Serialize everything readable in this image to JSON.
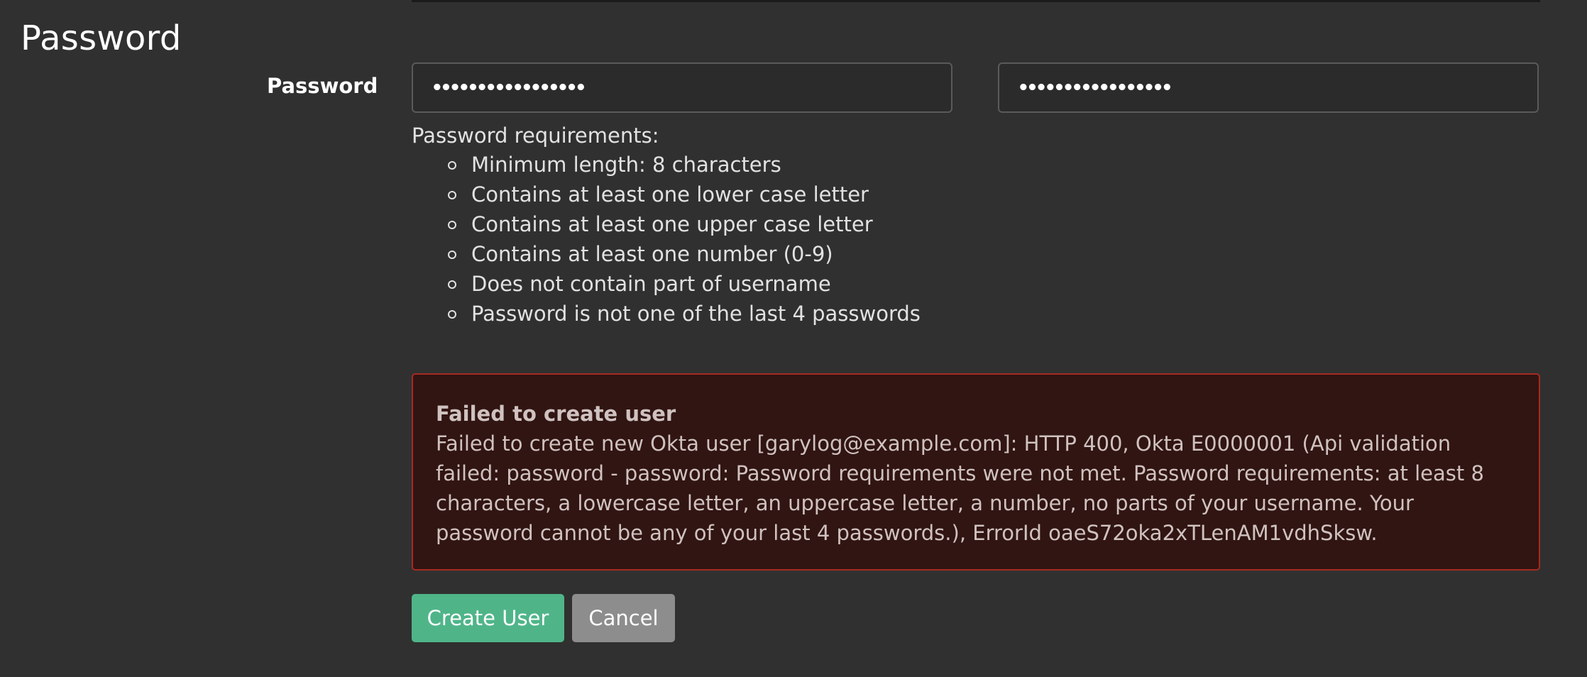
{
  "section": {
    "title": "Password"
  },
  "password_field": {
    "label": "Password",
    "value": "•••••••••••••••••",
    "confirm_value": "•••••••••••••••••"
  },
  "requirements": {
    "title": "Password requirements:",
    "items": [
      "Minimum length: 8 characters",
      "Contains at least one lower case letter",
      "Contains at least one upper case letter",
      "Contains at least one number (0-9)",
      "Does not contain part of username",
      "Password is not one of the last 4 passwords"
    ]
  },
  "error": {
    "title": "Failed to create user",
    "message": "Failed to create new Okta user [garylog@example.com]: HTTP 400, Okta E0000001 (Api validation failed: password - password: Password requirements were not met. Password requirements: at least 8 characters, a lowercase letter, an uppercase letter, a number, no parts of your username. Your password cannot be any of your last 4 passwords.), ErrorId oaeS72oka2xTLenAM1vdhSksw."
  },
  "actions": {
    "create_label": "Create User",
    "cancel_label": "Cancel"
  },
  "colors": {
    "background": "#303030",
    "primary_button": "#4fb589",
    "secondary_button": "#8d8d8d",
    "error_background": "#311512",
    "error_border": "#a52b22"
  }
}
